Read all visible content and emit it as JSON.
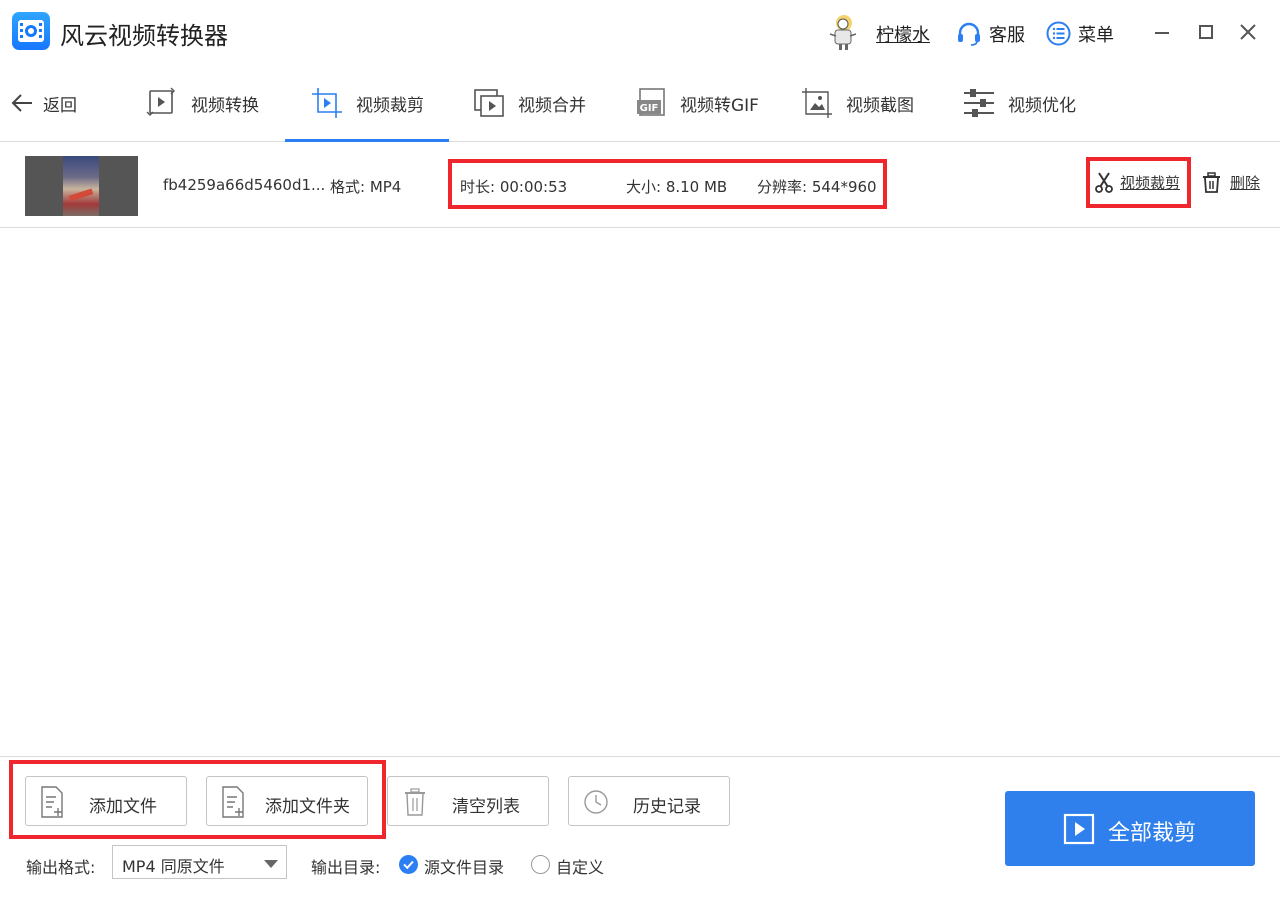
{
  "app": {
    "title": "风云视频转换器"
  },
  "header": {
    "username": "柠檬水",
    "support_label": "客服",
    "menu_label": "菜单"
  },
  "nav": {
    "back_label": "返回",
    "tabs": [
      {
        "label": "视频转换",
        "icon": "video-convert-icon"
      },
      {
        "label": "视频裁剪",
        "icon": "video-crop-icon",
        "active": true
      },
      {
        "label": "视频合并",
        "icon": "video-merge-icon"
      },
      {
        "label": "视频转GIF",
        "icon": "gif-icon"
      },
      {
        "label": "视频截图",
        "icon": "screenshot-icon"
      },
      {
        "label": "视频优化",
        "icon": "optimize-icon"
      }
    ]
  },
  "files": [
    {
      "name": "fb4259a66d5460d1...",
      "format": "格式: MP4",
      "duration": "时长: 00:00:53",
      "size": "大小: 8.10 MB",
      "resolution": "分辨率: 544*960",
      "crop_label": "视频裁剪",
      "delete_label": "删除"
    }
  ],
  "toolbar": {
    "add_file": "添加文件",
    "add_folder": "添加文件夹",
    "clear_list": "清空列表",
    "history": "历史记录"
  },
  "output": {
    "format_label": "输出格式:",
    "format_value": "MP4 同原文件",
    "dir_label": "输出目录:",
    "dir_source": "源文件目录",
    "dir_custom": "自定义",
    "selected": "源文件目录"
  },
  "start_button": "全部裁剪",
  "colors": {
    "accent": "#2f80ed",
    "highlight_border": "#f0262e"
  }
}
